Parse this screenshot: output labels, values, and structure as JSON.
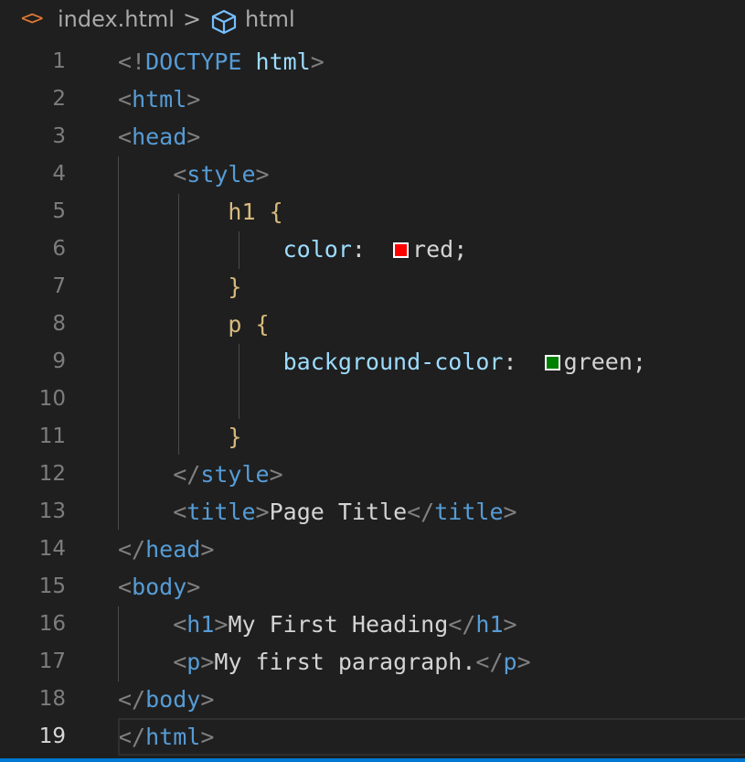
{
  "breadcrumb": {
    "file_icon": "<>",
    "file": "index.html",
    "separator": ">",
    "symbol_icon": "symbol-cube-icon",
    "symbol": "html"
  },
  "editor": {
    "current_line": 19,
    "lines": [
      {
        "n": "1",
        "tokens": [
          {
            "t": "<!",
            "c": "punct"
          },
          {
            "t": "DOCTYPE",
            "c": "tag"
          },
          {
            "t": " ",
            "c": "text"
          },
          {
            "t": "html",
            "c": "attr"
          },
          {
            "t": ">",
            "c": "punct"
          }
        ]
      },
      {
        "n": "2",
        "tokens": [
          {
            "t": "<",
            "c": "punct"
          },
          {
            "t": "html",
            "c": "tag"
          },
          {
            "t": ">",
            "c": "punct"
          }
        ]
      },
      {
        "n": "3",
        "tokens": [
          {
            "t": "<",
            "c": "punct"
          },
          {
            "t": "head",
            "c": "tag"
          },
          {
            "t": ">",
            "c": "punct"
          }
        ]
      },
      {
        "n": "4",
        "tokens": [
          {
            "t": "    ",
            "c": "text"
          },
          {
            "t": "<",
            "c": "punct"
          },
          {
            "t": "style",
            "c": "tag"
          },
          {
            "t": ">",
            "c": "punct"
          }
        ]
      },
      {
        "n": "5",
        "tokens": [
          {
            "t": "        ",
            "c": "text"
          },
          {
            "t": "h1",
            "c": "selector"
          },
          {
            "t": " ",
            "c": "text"
          },
          {
            "t": "{",
            "c": "brace"
          }
        ]
      },
      {
        "n": "6",
        "tokens": [
          {
            "t": "            ",
            "c": "text"
          },
          {
            "t": "color",
            "c": "attr"
          },
          {
            "t": ":  ",
            "c": "text"
          },
          {
            "swatch": "#ff0000"
          },
          {
            "t": "red;",
            "c": "text"
          }
        ]
      },
      {
        "n": "7",
        "tokens": [
          {
            "t": "        ",
            "c": "text"
          },
          {
            "t": "}",
            "c": "brace"
          }
        ]
      },
      {
        "n": "8",
        "tokens": [
          {
            "t": "        ",
            "c": "text"
          },
          {
            "t": "p",
            "c": "selector"
          },
          {
            "t": " ",
            "c": "text"
          },
          {
            "t": "{",
            "c": "brace"
          }
        ]
      },
      {
        "n": "9",
        "tokens": [
          {
            "t": "            ",
            "c": "text"
          },
          {
            "t": "background-color",
            "c": "attr"
          },
          {
            "t": ":  ",
            "c": "text"
          },
          {
            "swatch": "#008000"
          },
          {
            "t": "green;",
            "c": "text"
          }
        ]
      },
      {
        "n": "10",
        "tokens": []
      },
      {
        "n": "11",
        "tokens": [
          {
            "t": "        ",
            "c": "text"
          },
          {
            "t": "}",
            "c": "brace"
          }
        ]
      },
      {
        "n": "12",
        "tokens": [
          {
            "t": "    ",
            "c": "text"
          },
          {
            "t": "</",
            "c": "punct"
          },
          {
            "t": "style",
            "c": "tag"
          },
          {
            "t": ">",
            "c": "punct"
          }
        ]
      },
      {
        "n": "13",
        "tokens": [
          {
            "t": "    ",
            "c": "text"
          },
          {
            "t": "<",
            "c": "punct"
          },
          {
            "t": "title",
            "c": "tag"
          },
          {
            "t": ">",
            "c": "punct"
          },
          {
            "t": "Page Title",
            "c": "text"
          },
          {
            "t": "</",
            "c": "punct"
          },
          {
            "t": "title",
            "c": "tag"
          },
          {
            "t": ">",
            "c": "punct"
          }
        ]
      },
      {
        "n": "14",
        "tokens": [
          {
            "t": "</",
            "c": "punct"
          },
          {
            "t": "head",
            "c": "tag"
          },
          {
            "t": ">",
            "c": "punct"
          }
        ]
      },
      {
        "n": "15",
        "tokens": [
          {
            "t": "<",
            "c": "punct"
          },
          {
            "t": "body",
            "c": "tag"
          },
          {
            "t": ">",
            "c": "punct"
          }
        ]
      },
      {
        "n": "16",
        "tokens": [
          {
            "t": "    ",
            "c": "text"
          },
          {
            "t": "<",
            "c": "punct"
          },
          {
            "t": "h1",
            "c": "tag"
          },
          {
            "t": ">",
            "c": "punct"
          },
          {
            "t": "My First Heading",
            "c": "text"
          },
          {
            "t": "</",
            "c": "punct"
          },
          {
            "t": "h1",
            "c": "tag"
          },
          {
            "t": ">",
            "c": "punct"
          }
        ]
      },
      {
        "n": "17",
        "tokens": [
          {
            "t": "    ",
            "c": "text"
          },
          {
            "t": "<",
            "c": "punct"
          },
          {
            "t": "p",
            "c": "tag"
          },
          {
            "t": ">",
            "c": "punct"
          },
          {
            "t": "My first paragraph.",
            "c": "text"
          },
          {
            "t": "</",
            "c": "punct"
          },
          {
            "t": "p",
            "c": "tag"
          },
          {
            "t": ">",
            "c": "punct"
          }
        ]
      },
      {
        "n": "18",
        "tokens": [
          {
            "t": "</",
            "c": "punct"
          },
          {
            "t": "body",
            "c": "tag"
          },
          {
            "t": ">",
            "c": "punct"
          }
        ]
      },
      {
        "n": "19",
        "tokens": [
          {
            "t": "</",
            "c": "punct"
          },
          {
            "t": "html",
            "c": "tag"
          },
          {
            "t": ">",
            "c": "punct"
          }
        ]
      }
    ]
  },
  "colors": {
    "background": "#1f1f1f",
    "tag": "#569cd6",
    "attribute": "#9cdcfe",
    "selector": "#d7ba7d",
    "punctuation": "#808080",
    "text": "#d4d4d4",
    "accent": "#0078d4"
  }
}
